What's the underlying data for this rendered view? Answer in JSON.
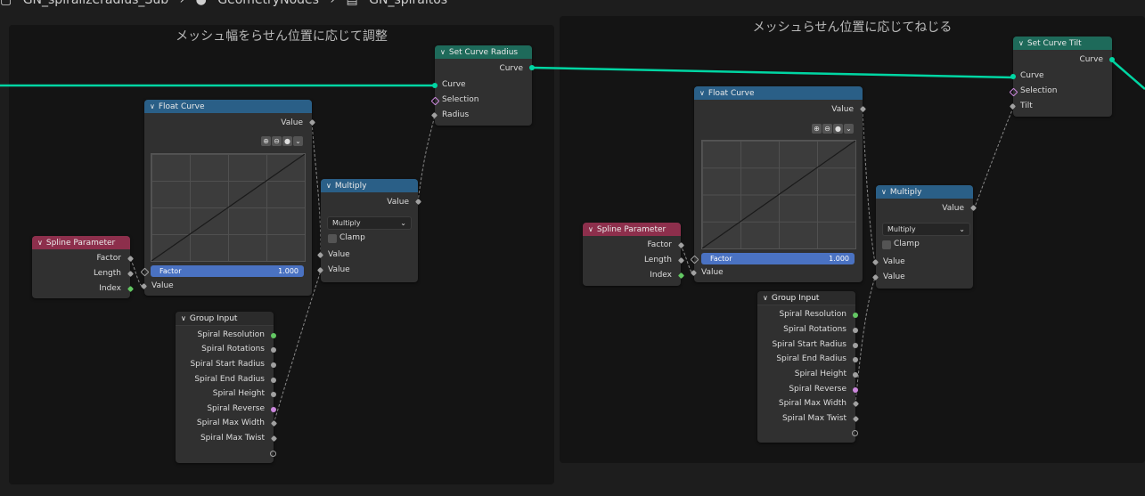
{
  "topbar": {
    "items": [
      "▢",
      "GN_spiralizeradius_Sub",
      "›",
      "●",
      "GeometryNodes",
      "›",
      "▤",
      "GN_spiraltos"
    ]
  },
  "frames": {
    "left": {
      "title": "メッシュ幅をらせん位置に応じて調整"
    },
    "right": {
      "title": "メッシュらせん位置に応じてねじる"
    }
  },
  "left": {
    "set_curve": {
      "title": "Set Curve Radius",
      "out_curve": "Curve",
      "in_curve": "Curve",
      "in_selection": "Selection",
      "in_radius": "Radius"
    },
    "float_curve": {
      "title": "Float Curve",
      "out_value": "Value",
      "factor_label": "Factor",
      "factor_value": "1.000",
      "in_value": "Value"
    },
    "multiply": {
      "title": "Multiply",
      "out_value": "Value",
      "operation": "Multiply",
      "clamp": "Clamp",
      "in_value1": "Value",
      "in_value2": "Value"
    },
    "spline": {
      "title": "Spline Parameter",
      "outputs": [
        "Factor",
        "Length",
        "Index"
      ]
    },
    "group_input": {
      "title": "Group Input",
      "outputs": [
        "Spiral Resolution",
        "Spiral Rotations",
        "Spiral Start Radius",
        "Spiral End Radius",
        "Spiral Height",
        "Spiral Reverse",
        "Spiral Max Width",
        "Spiral Max Twist"
      ]
    }
  },
  "right": {
    "set_curve": {
      "title": "Set Curve Tilt",
      "out_curve": "Curve",
      "in_curve": "Curve",
      "in_selection": "Selection",
      "in_tilt": "Tilt"
    },
    "float_curve": {
      "title": "Float Curve",
      "out_value": "Value",
      "factor_label": "Factor",
      "factor_value": "1.000",
      "in_value": "Value"
    },
    "multiply": {
      "title": "Multiply",
      "out_value": "Value",
      "operation": "Multiply",
      "clamp": "Clamp",
      "in_value1": "Value",
      "in_value2": "Value"
    },
    "spline": {
      "title": "Spline Parameter",
      "outputs": [
        "Factor",
        "Length",
        "Index"
      ]
    },
    "group_input": {
      "title": "Group Input",
      "outputs": [
        "Spiral Resolution",
        "Spiral Rotations",
        "Spiral Start Radius",
        "Spiral End Radius",
        "Spiral Height",
        "Spiral Reverse",
        "Spiral Max Width",
        "Spiral Max Twist"
      ]
    }
  },
  "colors": {
    "geometry_link": "#00d6a3",
    "float_link": "#a1a1a1",
    "header_geometry": "#1e6a5a",
    "header_utility": "#2a5f87",
    "header_input": "#8d2f4c"
  }
}
